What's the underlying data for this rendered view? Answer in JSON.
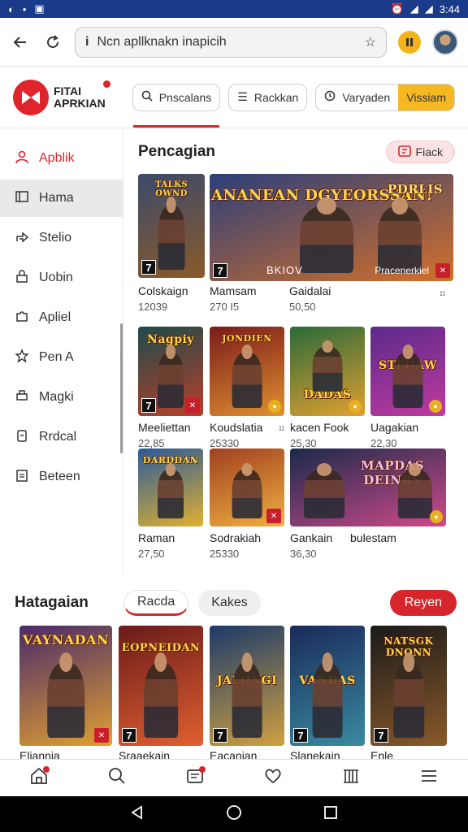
{
  "status_bar": {
    "time": "3:44"
  },
  "browser": {
    "url": "Ncn apllknakn inapicih"
  },
  "app": {
    "logo_text_1": "FITAI",
    "logo_text_2": "APRKIAN",
    "chips": [
      {
        "label": "Pnscalans",
        "icon": "search-icon"
      },
      {
        "label": "Rackkan",
        "icon": "list-icon"
      },
      {
        "label": "Varyaden",
        "icon": "clock-icon"
      },
      {
        "label": "Vissiam"
      }
    ]
  },
  "sidebar": {
    "items": [
      {
        "label": "Apblik",
        "icon": "user-icon"
      },
      {
        "label": "Hama",
        "icon": "bookmark-icon"
      },
      {
        "label": "Stelio",
        "icon": "share-icon"
      },
      {
        "label": "Uobin",
        "icon": "lock-icon"
      },
      {
        "label": "Apliel",
        "icon": "puzzle-icon"
      },
      {
        "label": "Pen A",
        "icon": "star-icon"
      },
      {
        "label": "Magki",
        "icon": "print-icon"
      },
      {
        "label": "Rrdcal",
        "icon": "battery-icon"
      },
      {
        "label": "Beteen",
        "icon": "clipboard-icon"
      }
    ]
  },
  "main": {
    "title": "Pencagian",
    "action_label": "Fiack",
    "banner_subtitle_a": "BKIOV",
    "banner_subtitle_b": "Pracenerkiel",
    "rows": [
      [
        {
          "name": "Colskaign",
          "value": "12039",
          "art_title": "TALKS OWND",
          "colors": [
            "#3b4a6b",
            "#8a5a2a"
          ]
        },
        {
          "name": "Mamsam",
          "value": "270 I5",
          "art_title": "NANANEAN DGYEORSSAN!",
          "colors": [
            "#2b3f7a",
            "#d3702a"
          ]
        },
        {
          "name": "Gaidalai",
          "value": "50,50",
          "art_title": "PDRLIS",
          "colors": [
            "#4a3a8a",
            "#d06a2a"
          ]
        }
      ],
      [
        {
          "name": "Meeliettan",
          "value": "22,85",
          "art_title": "Nagpiy",
          "colors": [
            "#1e4a4a",
            "#b8402a"
          ]
        },
        {
          "name": "Koudslatia",
          "value": "25330",
          "art_title": "JONDIEN",
          "colors": [
            "#7a1a1a",
            "#e09030"
          ]
        },
        {
          "name": "kacen Fook",
          "value": "25,30",
          "art_title": "DADAS",
          "colors": [
            "#2a6a3a",
            "#e0a030"
          ]
        },
        {
          "name": "Uagakian",
          "value": "22,30",
          "art_title": "STEGAW",
          "colors": [
            "#5a2a8a",
            "#c03aa0"
          ]
        }
      ],
      [
        {
          "name": "Raman",
          "value": "27,50",
          "art_title": "DARDDAN",
          "colors": [
            "#2a5a9a",
            "#e0b030"
          ]
        },
        {
          "name": "Sodrakiah",
          "value": "25330",
          "art_title": "",
          "colors": [
            "#a04020",
            "#f0b040"
          ]
        },
        {
          "name": "Gankain",
          "value": "36,30",
          "art_title": "MAPDAS DEINRS",
          "colors": [
            "#1a2a4a",
            "#d04a8a"
          ]
        },
        {
          "name": "bulestam",
          "value": "",
          "art_title": "",
          "colors": [
            "#2a2a3a",
            "#6a3a8a"
          ]
        }
      ]
    ]
  },
  "section2": {
    "title": "Hatagaian",
    "tab_1": "Racda",
    "tab_2": "Kakes",
    "action": "Reyen",
    "cards": [
      {
        "name": "Eliannia",
        "art_title": "VAYNADAN",
        "colors": [
          "#4a2a6a",
          "#e0a030"
        ]
      },
      {
        "name": "Sraaekain",
        "art_title": "EOPNEIDAN",
        "colors": [
          "#6a1a1a",
          "#e06030"
        ]
      },
      {
        "name": "Eacanian",
        "art_title": "JALONGI",
        "colors": [
          "#1a3a6a",
          "#d0a040"
        ]
      },
      {
        "name": "Slanekain",
        "art_title": "VANDAS",
        "colors": [
          "#1a2a5a",
          "#3a8aa0"
        ]
      },
      {
        "name": "Enle",
        "art_title": "NATSGK DNONN",
        "colors": [
          "#1a1a1a",
          "#8a5a2a"
        ]
      }
    ]
  },
  "colors": {
    "accent": "#d6262c",
    "status_bar": "#1a3a8a",
    "yellow": "#f5b820"
  }
}
